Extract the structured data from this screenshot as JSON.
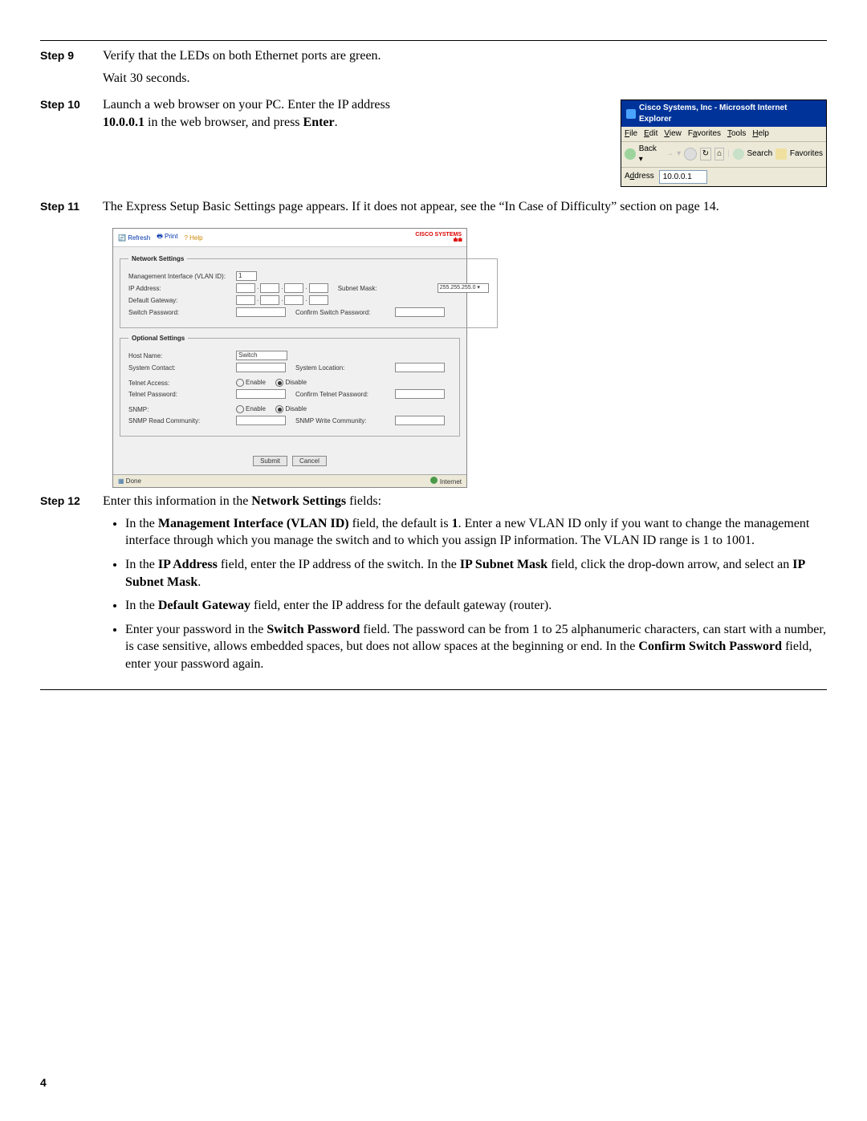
{
  "page_number": "4",
  "steps": {
    "s9": {
      "label": "Step 9",
      "line1": "Verify that the LEDs on both Ethernet ports are green.",
      "line2": "Wait 30 seconds."
    },
    "s10": {
      "label": "Step 10",
      "text_before": "Launch a web browser on your PC. Enter the IP address ",
      "ip": "10.0.0.1",
      "text_mid": " in the web browser, and press ",
      "enter": "Enter",
      "period": "."
    },
    "s11": {
      "label": "Step 11",
      "text": "The Express Setup Basic Settings page appears. If it does not appear, see the “In Case of Difficulty” section on page 14."
    },
    "s12": {
      "label": "Step 12",
      "intro_before": "Enter this information in the ",
      "intro_bold": "Network Settings",
      "intro_after": " fields:",
      "bullets": [
        {
          "parts": [
            {
              "t": "In the "
            },
            {
              "b": "Management Interface (VLAN ID)"
            },
            {
              "t": " field, the default is "
            },
            {
              "b": "1"
            },
            {
              "t": ". Enter a new VLAN ID only if you want to change the management interface through which you manage the switch and to which you assign IP information. The VLAN ID range is 1 to 1001."
            }
          ]
        },
        {
          "parts": [
            {
              "t": "In the "
            },
            {
              "b": "IP Address"
            },
            {
              "t": " field, enter the IP address of the switch. In the "
            },
            {
              "b": "IP Subnet Mask"
            },
            {
              "t": " field, click the drop-down arrow, and select an "
            },
            {
              "b": "IP Subnet Mask"
            },
            {
              "t": "."
            }
          ]
        },
        {
          "parts": [
            {
              "t": "In the "
            },
            {
              "b": "Default Gateway"
            },
            {
              "t": " field, enter the IP address for the default gateway (router)."
            }
          ]
        },
        {
          "parts": [
            {
              "t": "Enter your password in the "
            },
            {
              "b": "Switch Password"
            },
            {
              "t": " field. The password can be from 1 to 25 alphanumeric characters, can start with a number, is case sensitive, allows embedded spaces, but does not allow spaces at the beginning or end. In the "
            },
            {
              "b": "Confirm Switch Password"
            },
            {
              "t": " field, enter your password again."
            }
          ]
        }
      ]
    }
  },
  "browser": {
    "title": "Cisco Systems, Inc - Microsoft Internet Explorer",
    "menu": {
      "file": "File",
      "edit": "Edit",
      "view": "View",
      "favorites": "Favorites",
      "tools": "Tools",
      "help": "Help"
    },
    "toolbar": {
      "back": "Back",
      "search": "Search",
      "favorites": "Favorites"
    },
    "address_label": "Address",
    "address_value": "10.0.0.1"
  },
  "setup": {
    "toolbar": {
      "refresh": "Refresh",
      "print": "Print",
      "help": "Help"
    },
    "logo_lines": {
      "l1": "CISCO SYSTEMS"
    },
    "network": {
      "legend": "Network Settings",
      "vlan_label": "Management Interface (VLAN ID):",
      "vlan_value": "1",
      "ip_label": "IP Address:",
      "subnet_label": "Subnet Mask:",
      "subnet_value": "255.255.255.0",
      "gateway_label": "Default Gateway:",
      "pw_label": "Switch Password:",
      "pw_confirm_label": "Confirm Switch Password:"
    },
    "optional": {
      "legend": "Optional Settings",
      "host_label": "Host Name:",
      "host_value": "Switch",
      "contact_label": "System Contact:",
      "location_label": "System Location:",
      "telnet_access_label": "Telnet Access:",
      "enable": "Enable",
      "disable": "Disable",
      "telnet_pw_label": "Telnet Password:",
      "telnet_confirm_label": "Confirm Telnet Password:",
      "snmp_label": "SNMP:",
      "snmp_read_label": "SNMP Read Community:",
      "snmp_write_label": "SNMP Write Community:"
    },
    "buttons": {
      "submit": "Submit",
      "cancel": "Cancel"
    },
    "status": {
      "done": "Done",
      "internet": "Internet"
    }
  }
}
